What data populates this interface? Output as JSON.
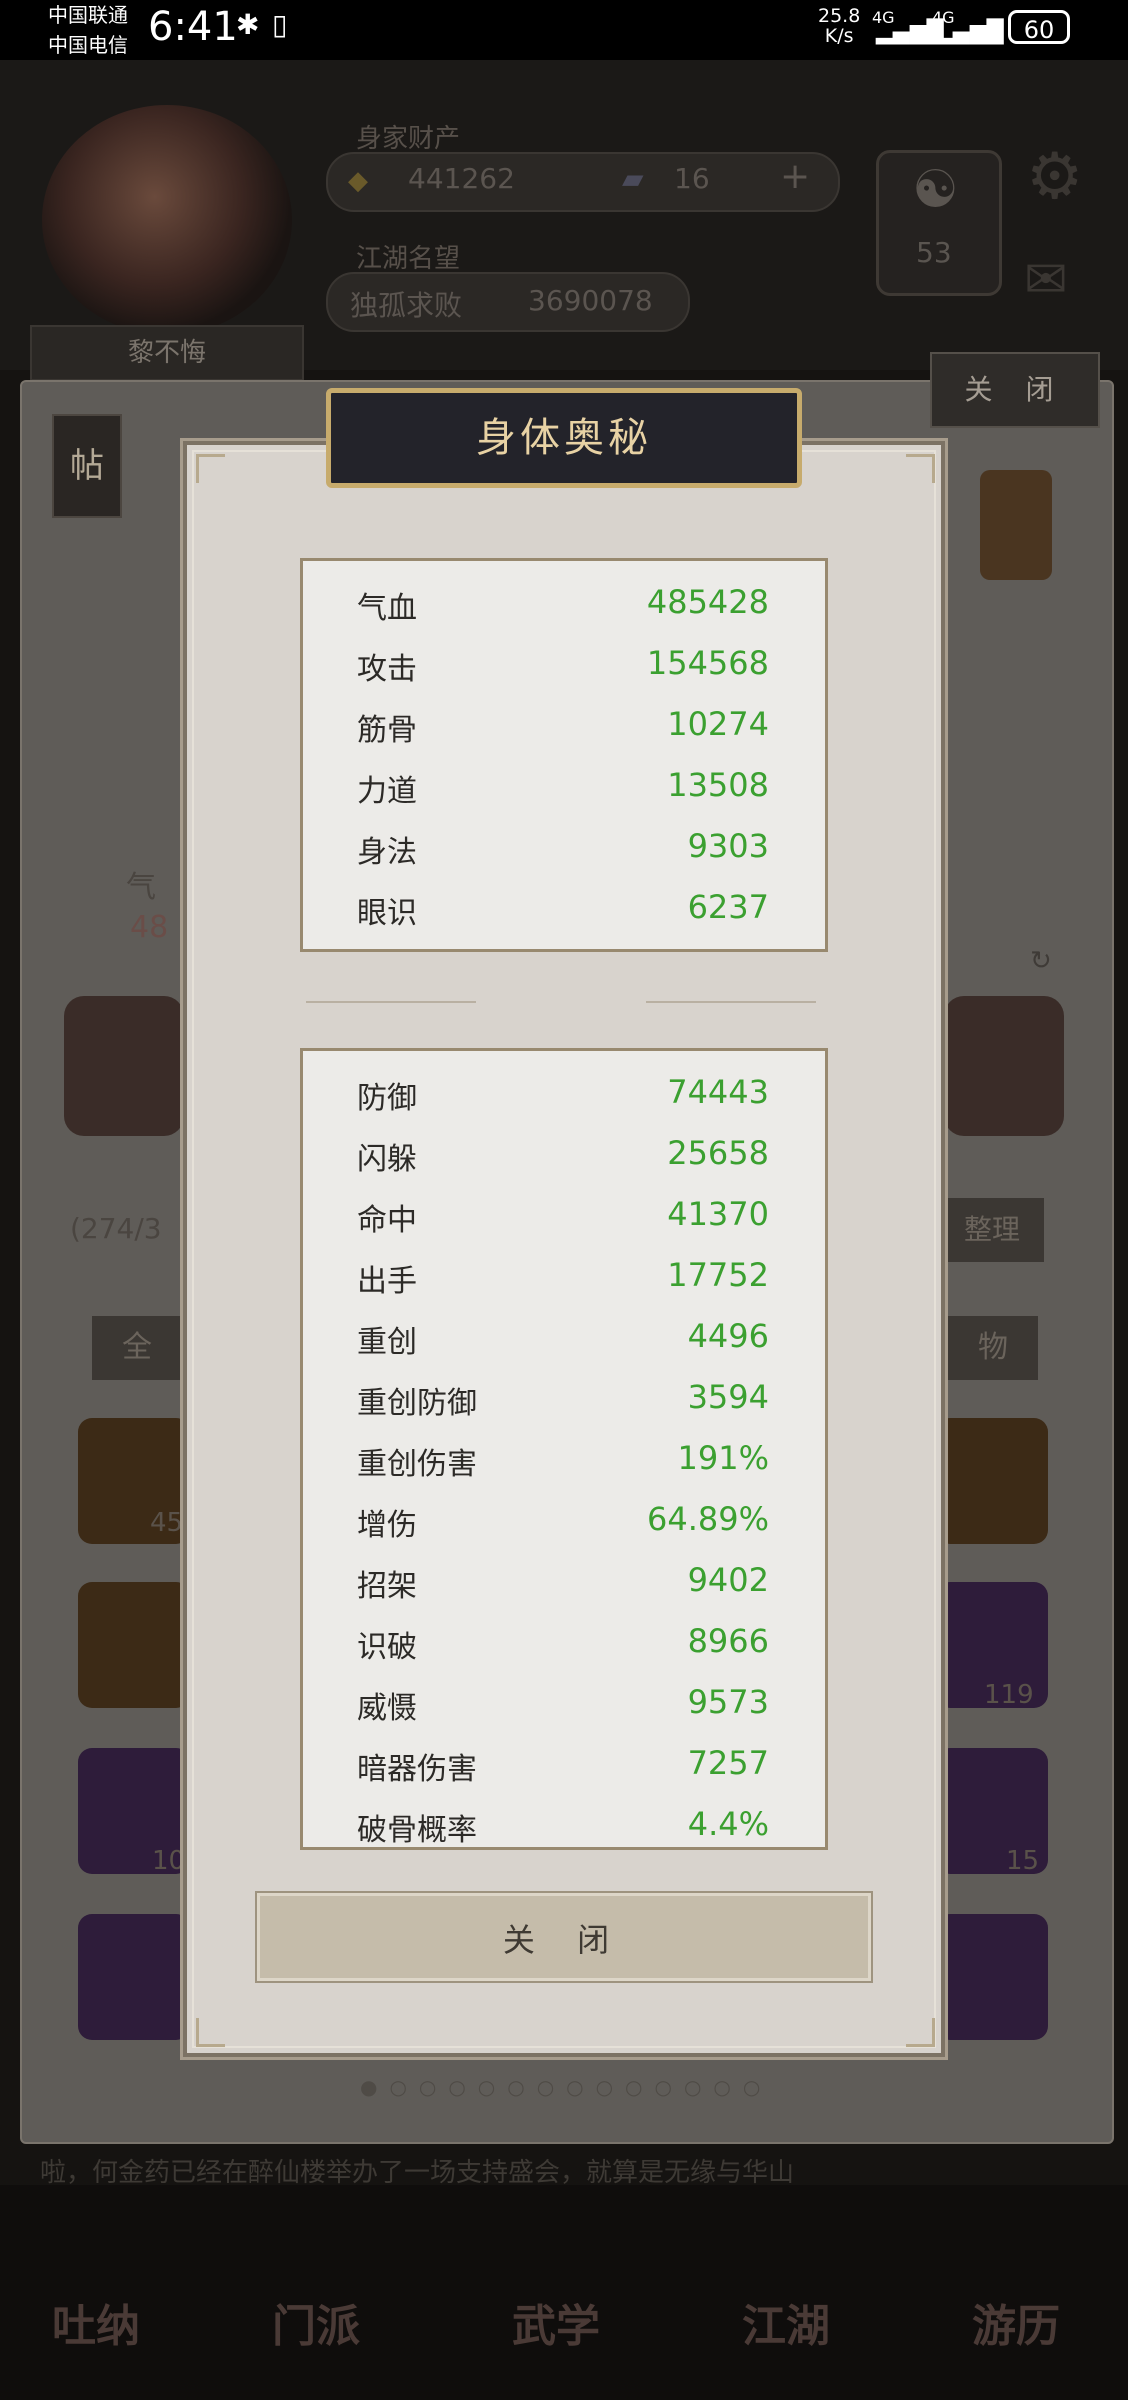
{
  "status_bar": {
    "carrier_1": "中国联通",
    "carrier_2": "中国电信",
    "time": "6:41",
    "net_speed_value": "25.8",
    "net_speed_unit": "K/s",
    "network_1": "4G",
    "network_2": "4G",
    "battery": "60"
  },
  "background": {
    "assets_label": "身家财产",
    "gold_value": "441262",
    "ticket_value": "16",
    "fame_label": "江湖名望",
    "fame_rank": "独孤求败",
    "fame_value": "3690078",
    "level_badge": "53",
    "player_name": "黎不悔",
    "close_label": "关 闭",
    "tie_label": "帖",
    "qixue_partial": "气",
    "qixue_value_partial": "48",
    "inventory_count_partial": "(274/3",
    "organize_label": "整理",
    "all_tab_partial": "全",
    "items_tab_partial": "物",
    "item_count_1": "45",
    "item_count_2": "10",
    "item_count_3": "119",
    "item_count_4": "15",
    "marquee_text": "啦，何金药已经在醉仙楼举办了一场支持盛会，就算是无缘与华山",
    "nav": [
      "吐纳",
      "门派",
      "武学",
      "江湖",
      "游历"
    ]
  },
  "dialog": {
    "title": "身体奥秘",
    "primary_stats": [
      {
        "name": "气血",
        "value": "485428"
      },
      {
        "name": "攻击",
        "value": "154568"
      },
      {
        "name": "筋骨",
        "value": "10274"
      },
      {
        "name": "力道",
        "value": "13508"
      },
      {
        "name": "身法",
        "value": "9303"
      },
      {
        "name": "眼识",
        "value": "6237"
      }
    ],
    "secondary_stats": [
      {
        "name": "防御",
        "value": "74443"
      },
      {
        "name": "闪躲",
        "value": "25658"
      },
      {
        "name": "命中",
        "value": "41370"
      },
      {
        "name": "出手",
        "value": "17752"
      },
      {
        "name": "重创",
        "value": "4496"
      },
      {
        "name": "重创防御",
        "value": "3594"
      },
      {
        "name": "重创伤害",
        "value": "191%"
      },
      {
        "name": "增伤",
        "value": "64.89%"
      },
      {
        "name": "招架",
        "value": "9402"
      },
      {
        "name": "识破",
        "value": "8966"
      },
      {
        "name": "威慑",
        "value": "9573"
      },
      {
        "name": "暗器伤害",
        "value": "7257"
      },
      {
        "name": "破骨概率",
        "value": "4.4%"
      }
    ],
    "close_button": "关 闭"
  },
  "colors": {
    "stat_value": "#3ba030",
    "title_text": "#e8d2a4",
    "title_border": "#c7ab6c"
  }
}
